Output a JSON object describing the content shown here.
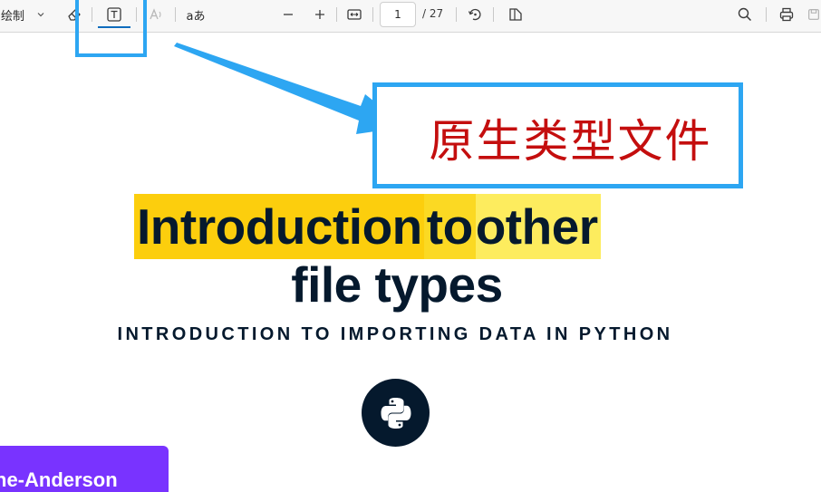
{
  "toolbar": {
    "draw_label": "绘制",
    "text_mode": "aあ",
    "page_current": "1",
    "page_total": "/ 27"
  },
  "icons": {
    "draw_dropdown": "chevron-down-icon",
    "erase": "eraser-icon",
    "text_box": "text-box-icon",
    "read_aloud": "read-aloud-icon",
    "zoom_out": "minus-icon",
    "zoom_in": "plus-icon",
    "fit": "fit-width-icon",
    "rotate": "rotate-icon",
    "page_view": "page-view-icon",
    "search": "search-icon",
    "print": "print-icon",
    "save": "save-icon"
  },
  "annotation": {
    "callout_text": "原生类型文件",
    "border_color": "#2da6f2",
    "text_color": "#c40e0e"
  },
  "slide": {
    "title_part1": "Introduction ",
    "title_part2": "to ",
    "title_part3": "other",
    "title_line2": "file types",
    "subtitle": "INTRODUCTION TO IMPORTING DATA IN PYTHON",
    "author": "ne-Anderson",
    "colors": {
      "navy": "#05192d",
      "highlight": "#fcce0d",
      "badge": "#7933ff"
    }
  }
}
